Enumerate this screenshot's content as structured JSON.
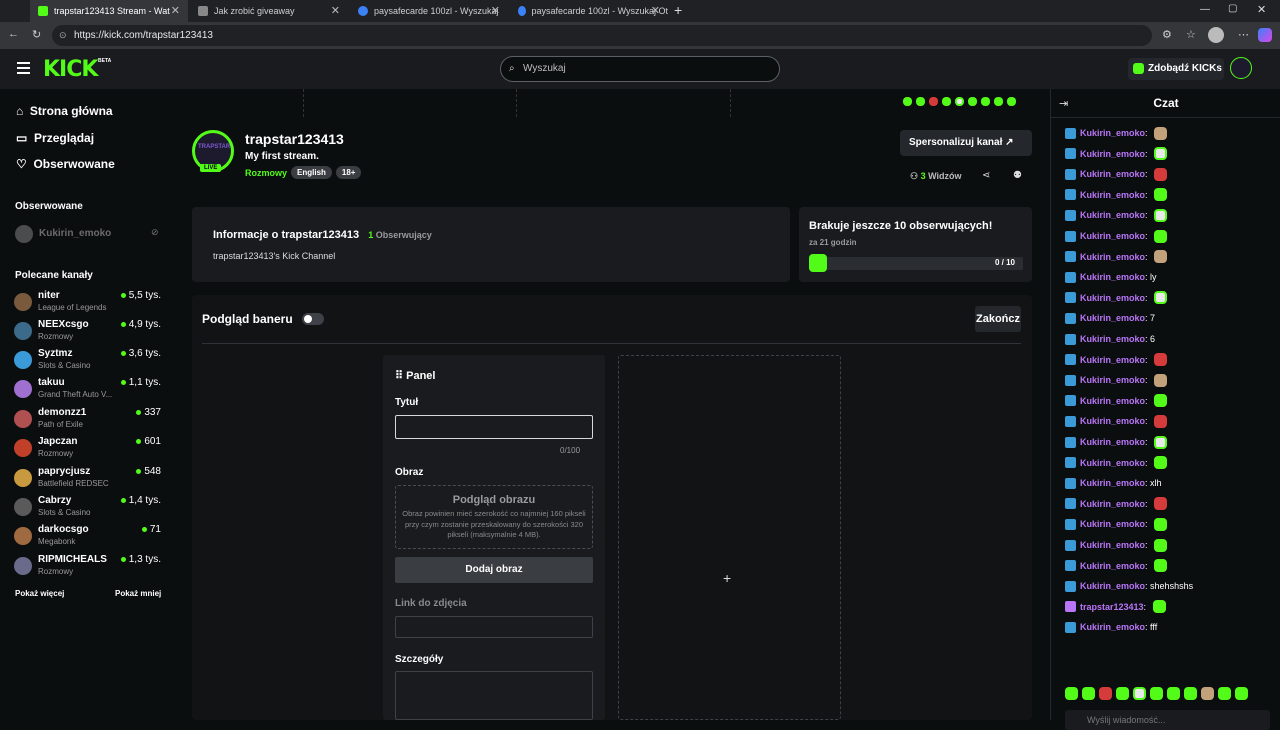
{
  "browser": {
    "tabs": [
      {
        "label": "trapstar123413 Stream - Wat",
        "active": true
      },
      {
        "label": "Jak zrobić giveaway",
        "active": false
      },
      {
        "label": "paysafecarde 100zl - Wyszukaj",
        "active": false
      },
      {
        "label": "paysafecarde 100zl - Wyszukaj Ot",
        "active": false
      }
    ],
    "url": "https://kick.com/trapstar123413",
    "new_tab": "+"
  },
  "header": {
    "logo": "KICK",
    "beta": "BETA",
    "search_placeholder": "Wyszukaj",
    "get_kicks": "Zdobądź KICKs"
  },
  "sidebar": {
    "nav": [
      {
        "label": "Strona główna",
        "icon": "home-icon"
      },
      {
        "label": "Przeglądaj",
        "icon": "browse-icon"
      },
      {
        "label": "Obserwowane",
        "icon": "heart-icon"
      }
    ],
    "followed_title": "Obserwowane",
    "followed": [
      {
        "name": "Kukirin_emoko"
      }
    ],
    "recommended_title": "Polecane kanały",
    "channels": [
      {
        "name": "niter",
        "category": "League of Legends",
        "viewers": "5,5 tys.",
        "color": "#7a5a3c"
      },
      {
        "name": "NEEXcsgo",
        "category": "Rozmowy",
        "viewers": "4,9 tys.",
        "color": "#3c6a8a"
      },
      {
        "name": "Syztmz",
        "category": "Slots & Casino",
        "viewers": "3,6 tys.",
        "color": "#3b9bd9"
      },
      {
        "name": "takuu",
        "category": "Grand Theft Auto V...",
        "viewers": "1,1 tys.",
        "color": "#a070d0"
      },
      {
        "name": "demonzz1",
        "category": "Path of Exile",
        "viewers": "337",
        "color": "#b05050"
      },
      {
        "name": "Japczan",
        "category": "Rozmowy",
        "viewers": "601",
        "color": "#c0402a"
      },
      {
        "name": "paprycjusz",
        "category": "Battlefield REDSEC",
        "viewers": "548",
        "color": "#c89a40"
      },
      {
        "name": "Cabrzy",
        "category": "Slots & Casino",
        "viewers": "1,4 tys.",
        "color": "#5a5a5a"
      },
      {
        "name": "darkocsgo",
        "category": "Megabonk",
        "viewers": "71",
        "color": "#a06a40"
      },
      {
        "name": "RIPMICHEALS",
        "category": "Rozmowy",
        "viewers": "1,3 tys.",
        "color": "#6a6a8a"
      }
    ],
    "show_more": "Pokaż więcej",
    "show_less": "Pokaż mniej"
  },
  "channel": {
    "name": "trapstar123413",
    "avatar_text": "TRAPSTAR",
    "live": "LIVE",
    "title": "My first stream.",
    "category": "Rozmowy",
    "tags": [
      "English",
      "18+"
    ],
    "customize_btn": "Spersonalizuj kanał",
    "viewers_count": "3",
    "viewers_label": "Widzów",
    "about_title": "Informacje o trapstar123413",
    "followers_count": "1",
    "followers_label": "Obserwujący",
    "about_text": "trapstar123413's Kick Channel",
    "goal_title": "Brakuje jeszcze 10 obserwujących!",
    "goal_time": "za 21 godzin",
    "goal_progress": "0 / 10",
    "goal_fraction": 0.0
  },
  "panel_editor": {
    "banner_preview": "Podgląd baneru",
    "banner_toggle_on": false,
    "finish": "Zakończ",
    "panel_title": "Panel",
    "title_label": "Tytuł",
    "title_value": "",
    "title_counter": "0/100",
    "image_label": "Obraz",
    "image_preview_title": "Podgląd obrazu",
    "image_preview_text": "Obraz powinien mieć szerokość co najmniej 160 pikseli przy czym zostanie przeskalowany do szerokości 320 pikseli (maksymalnie 4 MB).",
    "add_image": "Dodaj obraz",
    "link_label": "Link do zdjęcia",
    "details_label": "Szczegóły",
    "add_panel": "+"
  },
  "chat": {
    "title": "Czat",
    "messages": [
      {
        "user": "Kukirin_emoko",
        "text": "",
        "emote": "b"
      },
      {
        "user": "Kukirin_emoko",
        "text": "",
        "emote": "w"
      },
      {
        "user": "Kukirin_emoko",
        "text": "",
        "emote": "r"
      },
      {
        "user": "Kukirin_emoko",
        "text": "",
        "emote": "g"
      },
      {
        "user": "Kukirin_emoko",
        "text": "",
        "emote": "w"
      },
      {
        "user": "Kukirin_emoko",
        "text": "",
        "emote": "g"
      },
      {
        "user": "Kukirin_emoko",
        "text": "",
        "emote": "b"
      },
      {
        "user": "Kukirin_emoko",
        "text": "ly",
        "emote": ""
      },
      {
        "user": "Kukirin_emoko",
        "text": "",
        "emote": "w"
      },
      {
        "user": "Kukirin_emoko",
        "text": "7",
        "emote": ""
      },
      {
        "user": "Kukirin_emoko",
        "text": "6",
        "emote": ""
      },
      {
        "user": "Kukirin_emoko",
        "text": "",
        "emote": "r"
      },
      {
        "user": "Kukirin_emoko",
        "text": "",
        "emote": "b"
      },
      {
        "user": "Kukirin_emoko",
        "text": "",
        "emote": "g"
      },
      {
        "user": "Kukirin_emoko",
        "text": "",
        "emote": "r"
      },
      {
        "user": "Kukirin_emoko",
        "text": "",
        "emote": "w"
      },
      {
        "user": "Kukirin_emoko",
        "text": "",
        "emote": "g"
      },
      {
        "user": "Kukirin_emoko",
        "text": "xlh",
        "emote": ""
      },
      {
        "user": "Kukirin_emoko",
        "text": "",
        "emote": "r"
      },
      {
        "user": "Kukirin_emoko",
        "text": "",
        "emote": "g"
      },
      {
        "user": "Kukirin_emoko",
        "text": "",
        "emote": "g"
      },
      {
        "user": "Kukirin_emoko",
        "text": "",
        "emote": "g"
      },
      {
        "user": "Kukirin_emoko",
        "text": "shehshshs",
        "emote": ""
      },
      {
        "user": "trapstar123413",
        "text": "",
        "emote": "g",
        "broadcaster": true
      },
      {
        "user": "Kukirin_emoko",
        "text": "fff",
        "emote": ""
      }
    ],
    "input_placeholder": "Wyślij wiadomość..."
  },
  "colors": {
    "accent": "#53fc18",
    "bg": "#0b0e0f",
    "panel": "#191b1f",
    "chat_user": "#b875f7"
  }
}
